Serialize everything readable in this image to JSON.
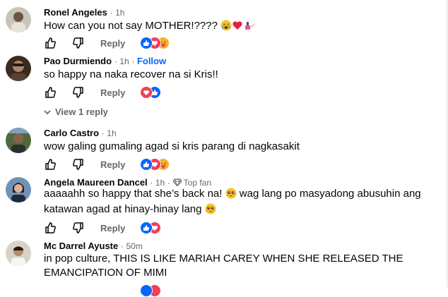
{
  "comments": [
    {
      "name": "Ronel Angeles",
      "time": "1h",
      "text": "How can you not say MOTHER!????",
      "text_emojis": [
        "crying-emoji",
        "red-heart-emoji",
        "nail-polish-emoji"
      ],
      "reply_label": "Reply",
      "reactions": [
        "like",
        "love",
        "care"
      ]
    },
    {
      "name": "Pao Durmiendo",
      "time": "1h",
      "follow_label": "Follow",
      "text": "so happy na naka recover na si Kris!!",
      "reply_label": "Reply",
      "reactions": [
        "love",
        "like"
      ],
      "view_replies_label": "View 1 reply"
    },
    {
      "name": "Carlo Castro",
      "time": "1h",
      "text": "wow galing gumaling agad si kris parang di nagkasakit",
      "reply_label": "Reply",
      "reactions": [
        "like",
        "love",
        "care"
      ]
    },
    {
      "name": "Angela Maureen Dancel",
      "time": "1h",
      "badge_label": "Top fan",
      "text_line1": "aaaaahh so happy that she’s back na!",
      "text_line1b": "wag lang po masyadong abusuhin ang",
      "text_line2": "katawan agad at hinay-hinay lang",
      "reply_label": "Reply",
      "reactions": [
        "like",
        "love"
      ]
    },
    {
      "name": "Mc Darrel Ayuste",
      "time": "50m",
      "text_line1": "in pop culture, THIS IS LIKE MARIAH CAREY WHEN SHE RELEASED THE",
      "text_line2": "EMANCIPATION OF MIMI"
    }
  ],
  "separator": "·",
  "colors": {
    "accent": "#0866ff",
    "muted": "#65676b",
    "like": "#0866ff",
    "love": "#f33e58",
    "care": "#f7b125"
  }
}
